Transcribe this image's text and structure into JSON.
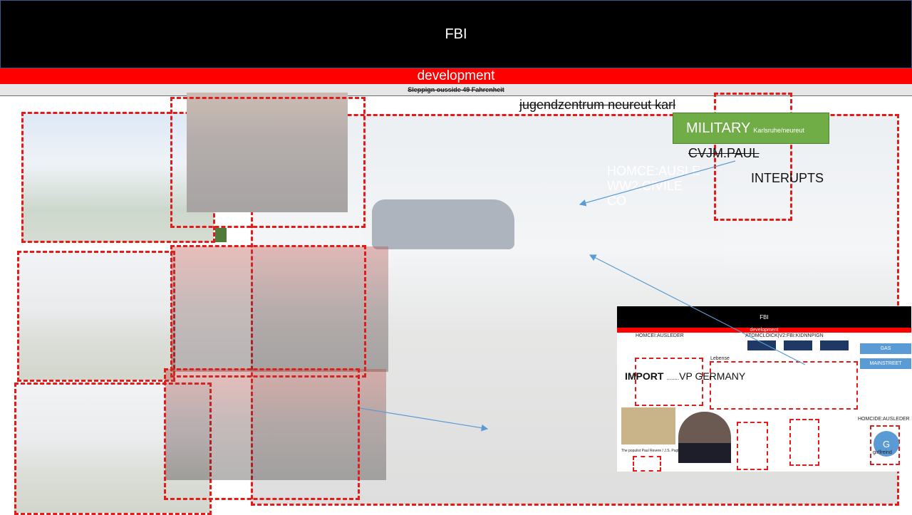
{
  "header": {
    "title": "FBI"
  },
  "dev_bar": {
    "label": "development"
  },
  "sub_bar": {
    "label": "Sleppign ousside 49 Fahrenheit"
  },
  "location_label": "jugendzentrum neureut karl",
  "military": {
    "label": "MILITARY",
    "sub": "Karlsruhe/neureut"
  },
  "cvjm_label": "CVJM.PAUL",
  "interrupts_label": "INTERUPTS",
  "faded_overlay": {
    "line1": "HOMCE:AUSLE",
    "line2": "WW2.CIVILE CO"
  },
  "inset": {
    "title": "FBI",
    "dev": "development",
    "homcei": "HOMCEI:AUSLEDER",
    "atom": "ATOMCLOICK|V2:FBI:KIDNNPIGN",
    "lebense": "Lebense",
    "gas": "GAS",
    "mainstreet": "MAINSTREET",
    "homcide": "HOMCIDE:AUSLEDER",
    "avatar_letter": "G",
    "avatar_caption": "girlfreind",
    "caption": "The populist Paul Revere / J.S. Pughe..."
  },
  "import_label": {
    "bold": "IMPORT",
    "dots": "........",
    "rest": "VP GERMANY"
  },
  "colors": {
    "header_bg": "#000000",
    "dev_bar": "#ff0000",
    "military_green": "#70ad47",
    "dash_red": "#e31b1b",
    "arrow_blue": "#5b9bd5"
  }
}
